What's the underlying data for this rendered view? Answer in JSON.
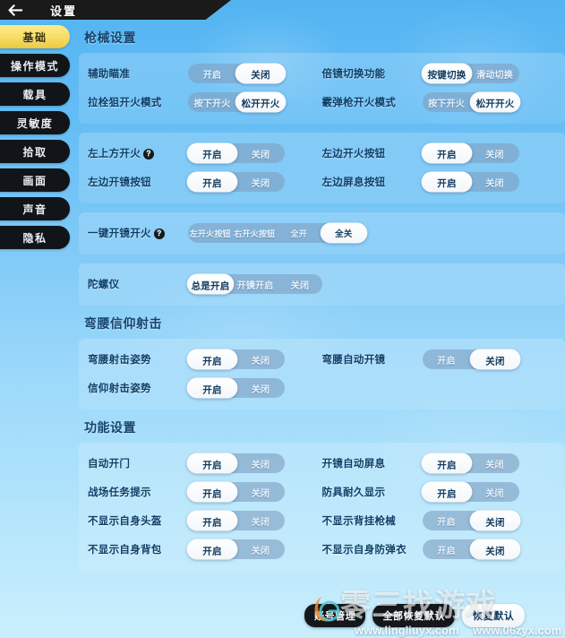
{
  "header": {
    "title": "设置",
    "back_icon": "back-arrow-icon"
  },
  "sidebar": {
    "items": [
      {
        "label": "基础",
        "active": true
      },
      {
        "label": "操作模式",
        "active": false
      },
      {
        "label": "载具",
        "active": false
      },
      {
        "label": "灵敏度",
        "active": false
      },
      {
        "label": "拾取",
        "active": false
      },
      {
        "label": "画面",
        "active": false
      },
      {
        "label": "声音",
        "active": false
      },
      {
        "label": "隐私",
        "active": false
      }
    ]
  },
  "sections": [
    {
      "title": "枪械设置",
      "panels": [
        {
          "rows": [
            [
              {
                "label": "辅助瞄准",
                "help": false,
                "options": [
                  "开启",
                  "关闭"
                ],
                "selected": 1
              },
              {
                "label": "倍镜切换功能",
                "help": false,
                "options": [
                  "按键切换",
                  "滑动切换"
                ],
                "selected": 0
              }
            ],
            [
              {
                "label": "拉栓狙开火模式",
                "help": false,
                "options": [
                  "按下开火",
                  "松开开火"
                ],
                "selected": 1
              },
              {
                "label": "霰弹枪开火模式",
                "help": false,
                "options": [
                  "按下开火",
                  "松开开火"
                ],
                "selected": 1
              }
            ]
          ]
        },
        {
          "rows": [
            [
              {
                "label": "左上方开火",
                "help": true,
                "options": [
                  "开启",
                  "关闭"
                ],
                "selected": 0
              },
              {
                "label": "左边开火按钮",
                "help": false,
                "options": [
                  "开启",
                  "关闭"
                ],
                "selected": 0
              }
            ],
            [
              {
                "label": "左边开镜按钮",
                "help": false,
                "options": [
                  "开启",
                  "关闭"
                ],
                "selected": 0
              },
              {
                "label": "左边屏息按钮",
                "help": false,
                "options": [
                  "开启",
                  "关闭"
                ],
                "selected": 0
              }
            ]
          ]
        },
        {
          "rows": [
            [
              {
                "label": "一键开镜开火",
                "help": true,
                "wide": true,
                "options": [
                  "左开火按钮",
                  "右开火按钮",
                  "全开",
                  "全关"
                ],
                "selected": 3
              }
            ]
          ]
        },
        {
          "rows": [
            [
              {
                "label": "陀螺仪",
                "help": false,
                "wide": true,
                "options": [
                  "总是开启",
                  "开镜开启",
                  "关闭"
                ],
                "selected": 0
              }
            ]
          ]
        }
      ]
    },
    {
      "title": "弯腰信仰射击",
      "panels": [
        {
          "rows": [
            [
              {
                "label": "弯腰射击姿势",
                "help": false,
                "options": [
                  "开启",
                  "关闭"
                ],
                "selected": 0
              },
              {
                "label": "弯腰自动开镜",
                "help": false,
                "options": [
                  "开启",
                  "关闭"
                ],
                "selected": 1
              }
            ],
            [
              {
                "label": "信仰射击姿势",
                "help": false,
                "options": [
                  "开启",
                  "关闭"
                ],
                "selected": 0
              }
            ]
          ]
        }
      ]
    },
    {
      "title": "功能设置",
      "panels": [
        {
          "rows": [
            [
              {
                "label": "自动开门",
                "help": false,
                "options": [
                  "开启",
                  "关闭"
                ],
                "selected": 0
              },
              {
                "label": "开镜自动屏息",
                "help": false,
                "options": [
                  "开启",
                  "关闭"
                ],
                "selected": 0
              }
            ],
            [
              {
                "label": "战场任务提示",
                "help": false,
                "options": [
                  "开启",
                  "关闭"
                ],
                "selected": 0
              },
              {
                "label": "防具耐久显示",
                "help": false,
                "options": [
                  "开启",
                  "关闭"
                ],
                "selected": 0
              }
            ],
            [
              {
                "label": "不显示自身头盔",
                "help": false,
                "options": [
                  "开启",
                  "关闭"
                ],
                "selected": 0
              },
              {
                "label": "不显示背挂枪械",
                "help": false,
                "options": [
                  "开启",
                  "关闭"
                ],
                "selected": 1
              }
            ],
            [
              {
                "label": "不显示自身背包",
                "help": false,
                "options": [
                  "开启",
                  "关闭"
                ],
                "selected": 0
              },
              {
                "label": "不显示自身防弹衣",
                "help": false,
                "options": [
                  "开启",
                  "关闭"
                ],
                "selected": 1
              }
            ]
          ]
        }
      ]
    }
  ],
  "bottom_bar": {
    "account_label": "账号管理",
    "reset_all_label": "全部恢复默认",
    "reset_label": "恢复默认"
  },
  "watermarks": {
    "brand": "零三找游戏",
    "url_left": "www.lingliuyx.com",
    "url_right": "www.06zyx.com"
  },
  "colors": {
    "accent_yellow": "#f6dc62",
    "label_blue": "#0f3f68",
    "track": "#7ea0c2",
    "dark": "#14171b"
  }
}
